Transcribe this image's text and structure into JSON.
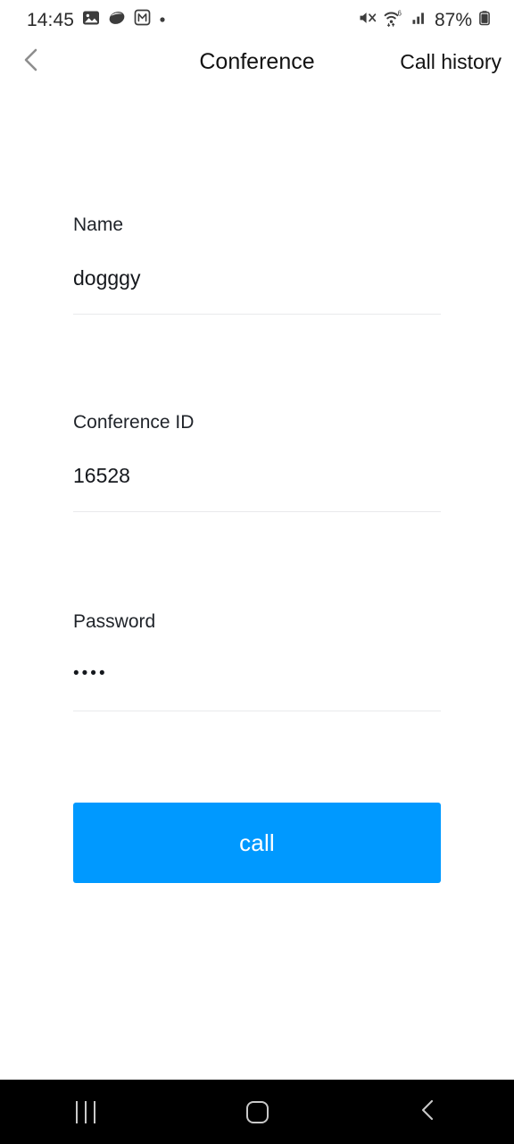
{
  "status_bar": {
    "time": "14:45",
    "left_icons": [
      "gallery-icon",
      "samsung-internet-icon",
      "m-app-icon",
      "dot-indicator-icon"
    ],
    "right_icons": [
      "mute-icon",
      "wifi-6-icon",
      "cellular-signal-icon",
      "battery-icon"
    ],
    "wifi_generation": "6",
    "battery_percent": "87%"
  },
  "header": {
    "back_label": "back-chevron",
    "title": "Conference",
    "call_history_label": "Call history"
  },
  "form": {
    "fields": [
      {
        "label": "Name",
        "value": "dogggy",
        "masked": false
      },
      {
        "label": "Conference ID",
        "value": "16528",
        "masked": false
      },
      {
        "label": "Password",
        "value": "••••",
        "masked": true
      }
    ]
  },
  "actions": {
    "call_label": "call"
  },
  "nav_bar": {
    "recents_label": "recents-icon",
    "home_label": "home-icon",
    "back_label": "back-icon"
  },
  "colors": {
    "accent_blue": "#0099ff",
    "text_primary": "#15181d",
    "divider": "#e9eaec",
    "nav_background": "#000000",
    "nav_icon": "#c9c9c9"
  }
}
